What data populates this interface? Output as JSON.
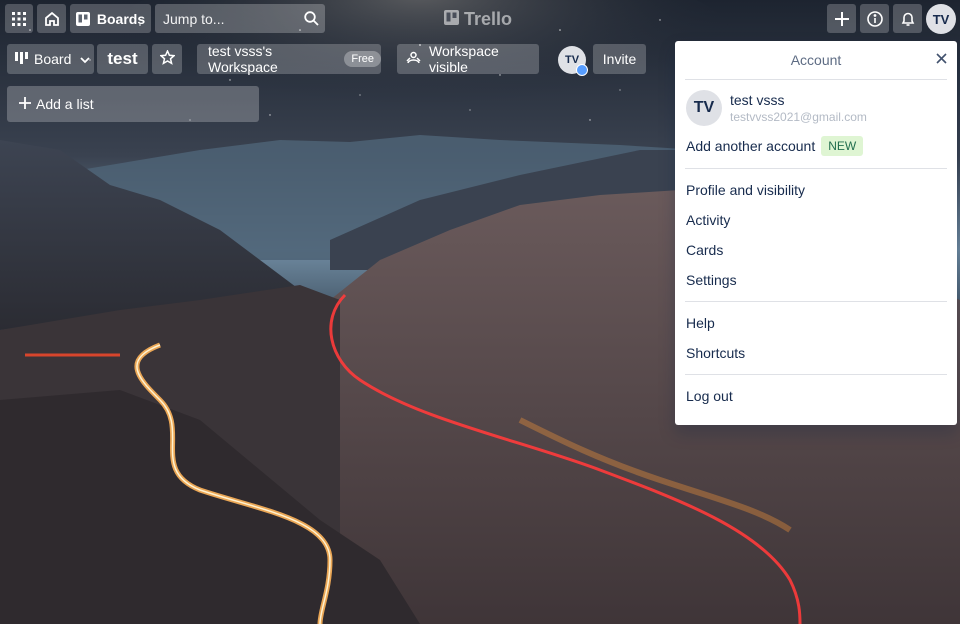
{
  "header": {
    "apps_icon": "grid-icon",
    "home_icon": "home-icon",
    "boards_label": "Boards",
    "search_placeholder": "Jump to...",
    "logo_text": "Trello",
    "avatar_initials": "TV"
  },
  "board": {
    "view_label": "Board",
    "name": "test",
    "workspace_label": "test vsss's Workspace",
    "plan_badge": "Free",
    "visibility_label": "Workspace visible",
    "member_initials": "TV",
    "invite_label": "Invite",
    "add_list_label": "Add a list"
  },
  "account_menu": {
    "title": "Account",
    "user_initials": "TV",
    "user_name": "test vsss",
    "user_email": "testvvss2021@gmail.com",
    "add_account_label": "Add another account",
    "new_badge": "NEW",
    "items_group1": [
      {
        "label": "Profile and visibility"
      },
      {
        "label": "Activity"
      },
      {
        "label": "Cards"
      },
      {
        "label": "Settings"
      }
    ],
    "items_group2": [
      {
        "label": "Help"
      },
      {
        "label": "Shortcuts"
      }
    ],
    "logout_label": "Log out"
  },
  "colors": {
    "header_button_bg": "rgba(255,255,255,0.22)",
    "new_badge_bg": "#dff5d3",
    "new_badge_text": "#216e4e",
    "text_primary": "#172b4d"
  }
}
